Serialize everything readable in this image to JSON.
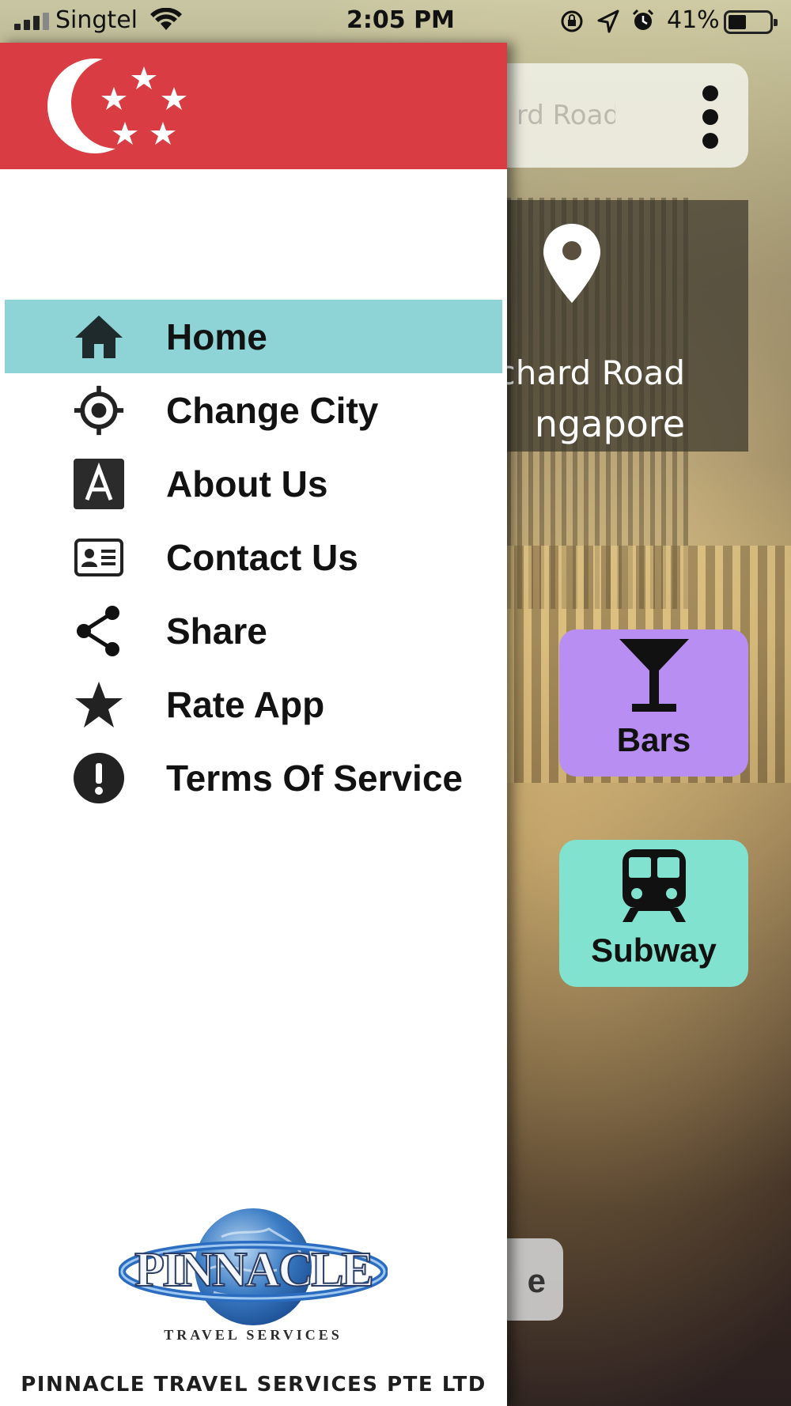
{
  "status_bar": {
    "carrier": "Singtel",
    "time": "2:05 PM",
    "battery": "41%"
  },
  "background_app": {
    "search_placeholder": "rd Road",
    "location_line1": "chard Road",
    "location_line2": "ngapore",
    "tiles": [
      {
        "label": "Bars",
        "icon": "cocktail-icon",
        "color": "#b98ef2"
      },
      {
        "label": "Subway",
        "icon": "train-icon",
        "color": "#81e3cf"
      }
    ],
    "bottom_button_fragment": "e"
  },
  "drawer": {
    "header_color": "#d93c42",
    "header_emblem": "singapore-flag-crescent-stars",
    "menu": [
      {
        "label": "Home",
        "icon": "home-icon",
        "active": true
      },
      {
        "label": "Change City",
        "icon": "crosshair-icon",
        "active": false
      },
      {
        "label": "About Us",
        "icon": "letter-a-icon",
        "active": false
      },
      {
        "label": "Contact Us",
        "icon": "contact-card-icon",
        "active": false
      },
      {
        "label": "Share",
        "icon": "share-icon",
        "active": false
      },
      {
        "label": "Rate App",
        "icon": "star-icon",
        "active": false
      },
      {
        "label": "Terms Of Service",
        "icon": "exclamation-icon",
        "active": false
      }
    ],
    "active_color": "#8ed4d6",
    "logo_text": "PINNACLE",
    "logo_subtext": "TRAVEL SERVICES",
    "company_name": "PINNACLE TRAVEL SERVICES PTE LTD"
  }
}
